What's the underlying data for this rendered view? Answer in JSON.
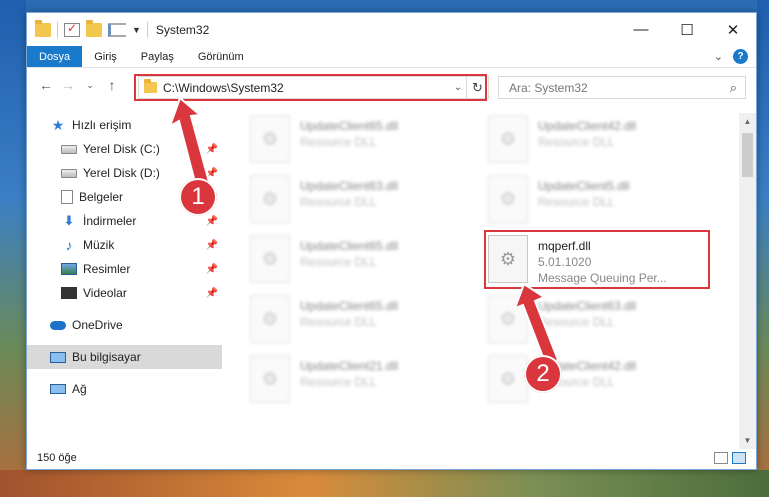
{
  "window": {
    "title": "System32",
    "minimize": "—",
    "maximize": "☐",
    "close": "✕"
  },
  "ribbon": {
    "tabs": [
      "Dosya",
      "Giriş",
      "Paylaş",
      "Görünüm"
    ],
    "help": "?"
  },
  "address": {
    "path": "C:\\Windows\\System32",
    "search_placeholder": "Ara: System32"
  },
  "sidebar": {
    "items": [
      {
        "label": "Hızlı erişim",
        "icon": "star-icon"
      },
      {
        "label": "Yerel Disk (C:)",
        "icon": "drive-icon",
        "pinned": true
      },
      {
        "label": "Yerel Disk (D:)",
        "icon": "drive-icon",
        "pinned": true
      },
      {
        "label": "Belgeler",
        "icon": "documents-icon",
        "pinned": true
      },
      {
        "label": "İndirmeler",
        "icon": "downloads-icon",
        "pinned": true
      },
      {
        "label": "Müzik",
        "icon": "music-icon",
        "pinned": true
      },
      {
        "label": "Resimler",
        "icon": "pictures-icon",
        "pinned": true
      },
      {
        "label": "Videolar",
        "icon": "videos-icon",
        "pinned": true
      },
      {
        "label": "OneDrive",
        "icon": "cloud-icon"
      },
      {
        "label": "Bu bilgisayar",
        "icon": "pc-icon",
        "selected": true
      },
      {
        "label": "Ağ",
        "icon": "network-icon"
      }
    ]
  },
  "files": [
    {
      "name": "UpdateClient65.dll",
      "line1": "Resource DLL",
      "blurred": true
    },
    {
      "name": "UpdateClient42.dll",
      "line1": "Resource DLL",
      "blurred": true
    },
    {
      "name": "UpdateClient63.dll",
      "line1": "Resource DLL",
      "blurred": true
    },
    {
      "name": "UpdateClient5.dll",
      "line1": "Resource DLL",
      "blurred": true
    },
    {
      "name": "UpdateClient65.dll",
      "line1": "Resource DLL",
      "blurred": true
    },
    {
      "name": "mqperf.dll",
      "line1": "5.01.1020",
      "line2": "Message Queuing Per...",
      "blurred": false
    },
    {
      "name": "UpdateClient65.dll",
      "line1": "Resource DLL",
      "blurred": true
    },
    {
      "name": "UpdateClient63.dll",
      "line1": "Resource DLL",
      "blurred": true
    },
    {
      "name": "UpdateClient21.dll",
      "line1": "Resource DLL",
      "blurred": true
    },
    {
      "name": "UpdateClient42.dll",
      "line1": "Resource DLL",
      "blurred": true
    }
  ],
  "status": {
    "count": "150 öğe"
  },
  "annotations": {
    "badge1": "1",
    "badge2": "2",
    "color": "#d9363e"
  }
}
